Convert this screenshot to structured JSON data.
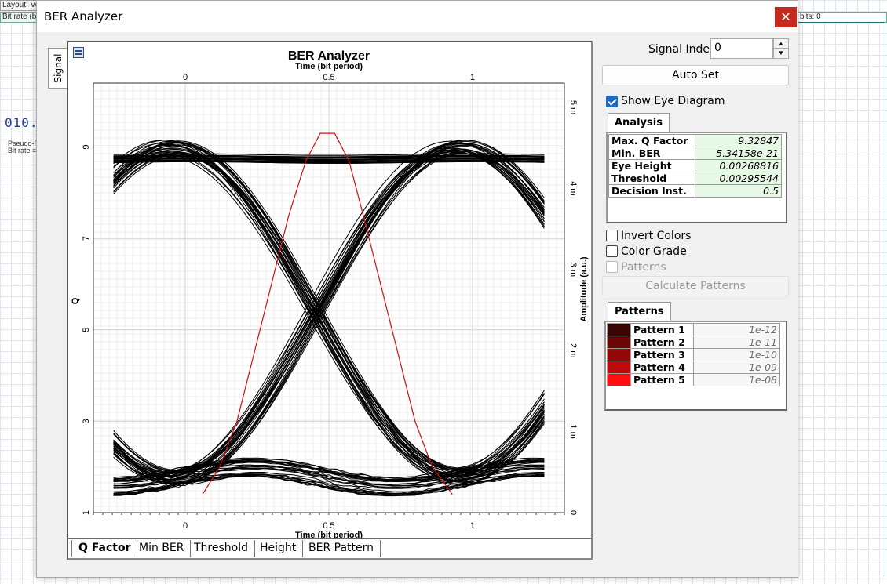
{
  "background": {
    "top_left_1": "Layout: Ve",
    "top_left_2": "Bit rate (bi",
    "top_right": "bits:  0",
    "component_glyph": "010..",
    "component_label_1": "Pseudo-R",
    "component_label_2": "Bit rate ="
  },
  "window": {
    "title": "BER Analyzer",
    "close_glyph": "✕",
    "side_tab": "Signal"
  },
  "chart": {
    "tabs": [
      {
        "label": "Q Factor",
        "active": true
      },
      {
        "label": "Min BER",
        "active": false
      },
      {
        "label": "Threshold",
        "active": false
      },
      {
        "label": "Height",
        "active": false
      },
      {
        "label": "BER Pattern",
        "active": false
      }
    ]
  },
  "chart_data": {
    "type": "line",
    "title": "BER Analyzer",
    "xlabel_top": "Time (bit period)",
    "xlabel": "Time (bit period)",
    "ylabel_left": "Q",
    "ylabel_right": "Amplitude (a.u.)",
    "xlim": [
      -0.32,
      1.32
    ],
    "ylim_left": [
      1,
      10.4
    ],
    "ylim_right": [
      0,
      5.3
    ],
    "x_ticks": [
      "0",
      "0.5",
      "1"
    ],
    "x_tick_values": [
      0,
      0.5,
      1
    ],
    "y_left_ticks": [
      "1",
      "3",
      "5",
      "7",
      "9"
    ],
    "y_left_tick_values": [
      1,
      3,
      5,
      7,
      9
    ],
    "y_right_ticks": [
      "0",
      "1 m",
      "2 m",
      "3 m",
      "4 m",
      "5 m"
    ],
    "y_right_tick_values": [
      0,
      1,
      2,
      3,
      4,
      5
    ],
    "grid": true,
    "series": [
      {
        "color": "#d01010",
        "axis": "left",
        "x": [
          0.06,
          0.12,
          0.18,
          0.24,
          0.3,
          0.36,
          0.42,
          0.47,
          0.52,
          0.57,
          0.62,
          0.68,
          0.74,
          0.8,
          0.86,
          0.93
        ],
        "y": [
          1.4,
          2.0,
          3.0,
          4.5,
          6.0,
          7.5,
          8.7,
          9.3,
          9.3,
          8.7,
          7.5,
          6.0,
          4.5,
          3.0,
          2.0,
          1.4
        ]
      }
    ],
    "eye_diagram": {
      "high_level": 4.5,
      "low_level": 0.45,
      "crossing_level": 2.45,
      "crossing_times": [
        0,
        1
      ],
      "x_range": [
        -0.25,
        1.25
      ]
    }
  },
  "panel": {
    "signal_index_label": "Signal Index:",
    "signal_index_value": "0",
    "autoset_label": "Auto Set",
    "show_eye_label": "Show Eye Diagram",
    "analysis_tab": "Analysis",
    "analysis": [
      {
        "key": "Max. Q Factor",
        "value": "9.32847"
      },
      {
        "key": "Min. BER",
        "value": "5.34158e-21"
      },
      {
        "key": "Eye Height",
        "value": "0.00268816"
      },
      {
        "key": "Threshold",
        "value": "0.00295544"
      },
      {
        "key": "Decision Inst.",
        "value": "0.5"
      }
    ],
    "invert_colors_label": "Invert Colors",
    "color_grade_label": "Color Grade",
    "patterns_check_label": "Patterns",
    "calculate_label": "Calculate Patterns",
    "patterns_tab": "Patterns",
    "patterns": [
      {
        "name": "Pattern 1",
        "value": "1e-12",
        "color": "#3a0505"
      },
      {
        "name": "Pattern 2",
        "value": "1e-11",
        "color": "#6a0707"
      },
      {
        "name": "Pattern 3",
        "value": "1e-10",
        "color": "#950808"
      },
      {
        "name": "Pattern 4",
        "value": "1e-09",
        "color": "#c00a0a"
      },
      {
        "name": "Pattern 5",
        "value": "1e-08",
        "color": "#ff1010"
      }
    ]
  }
}
